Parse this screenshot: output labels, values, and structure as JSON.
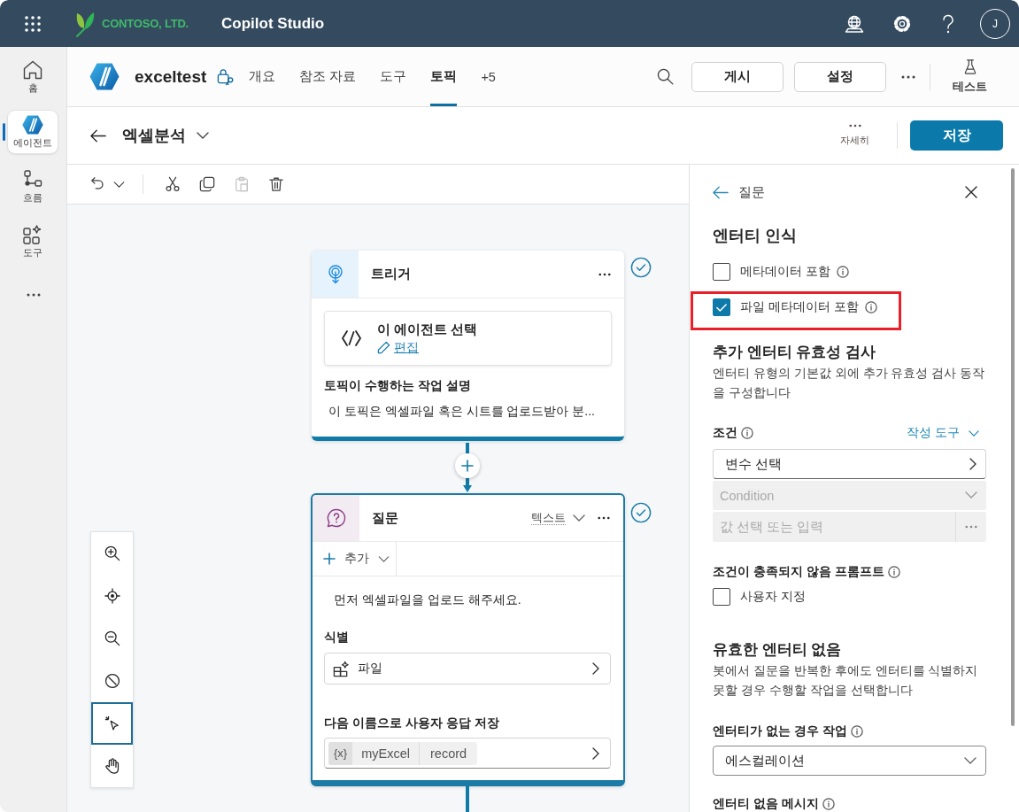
{
  "header": {
    "org_name": "CONTOSO, LTD.",
    "app_name": "Copilot Studio",
    "avatar_initial": "J"
  },
  "rail": {
    "items": [
      {
        "kind": "home",
        "label": "홈",
        "selected": false
      },
      {
        "kind": "agent",
        "label": "에이전트",
        "selected": true
      },
      {
        "kind": "flow",
        "label": "흐름",
        "selected": false
      },
      {
        "kind": "tools",
        "label": "도구",
        "selected": false
      }
    ]
  },
  "agent_bar": {
    "agent_name": "exceltest",
    "tabs": [
      {
        "label": "개요",
        "selected": false
      },
      {
        "label": "참조 자료",
        "selected": false
      },
      {
        "label": "도구",
        "selected": false
      },
      {
        "label": "토픽",
        "selected": true
      },
      {
        "label": "+5",
        "selected": false
      }
    ],
    "buttons": [
      "게시",
      "설정"
    ],
    "test_label": "테스트"
  },
  "topic_bar": {
    "topic_name": "엑셀분석",
    "more_label": "자세히",
    "save_label": "저장"
  },
  "toolbar": {
    "actions": [
      {
        "kind": "undo",
        "disabled": false
      },
      {
        "kind": "cut",
        "disabled": false
      },
      {
        "kind": "copy",
        "disabled": false
      },
      {
        "kind": "paste",
        "disabled": true
      },
      {
        "kind": "delete",
        "disabled": false
      }
    ]
  },
  "canvas": {
    "trigger_node": {
      "title": "트리거",
      "validated": true,
      "action_title": "이 에이전트 선택",
      "action_link": "편집",
      "description_label": "토픽이 수행하는 작업 설명",
      "description": "이 토픽은 엑셀파일 혹은 시트를 업로드받아 분..."
    },
    "question_node": {
      "title": "질문",
      "selected": true,
      "validated": true,
      "response_type": "텍스트",
      "add_label": "추가",
      "message": "먼저 엑셀파일을 업로드 해주세요.",
      "identify_label": "식별",
      "identify_value": "파일",
      "save_label": "다음 이름으로 사용자 응답 저장",
      "variable_symbol": "{x}",
      "variable_name": "myExcel",
      "variable_type": "record"
    },
    "zoom_controls": [
      {
        "kind": "zoom-in",
        "selected": false
      },
      {
        "kind": "recenter",
        "selected": false
      },
      {
        "kind": "zoom-out",
        "selected": false
      },
      {
        "kind": "minimap",
        "selected": false
      },
      {
        "kind": "select",
        "selected": true
      },
      {
        "kind": "pan",
        "selected": false
      }
    ]
  },
  "properties_panel": {
    "back_label": "질문",
    "title": "엔터티 인식",
    "checkboxes": [
      {
        "label": "메타데이터 포함",
        "checked": false,
        "highlighted": false
      },
      {
        "label": "파일 메타데이터 포함",
        "checked": true,
        "highlighted": true
      }
    ],
    "validation": {
      "title": "추가 엔터티 유효성 검사",
      "description": "엔터티 유형의 기본값 외에 추가 유효성 검사 동작을 구성합니다",
      "condition_label": "조건",
      "formula_link": "작성 도구",
      "variable_picker": "변수 선택",
      "operator_field": {
        "placeholder": "Condition",
        "disabled": true
      },
      "value_field": {
        "placeholder": "값 선택 또는 입력",
        "disabled": true
      }
    },
    "unmet_prompt": {
      "title": "조건이 충족되지 않음 프롬프트",
      "checkbox": {
        "label": "사용자 지정",
        "checked": false
      }
    },
    "no_entity": {
      "title": "유효한 엔터티 없음",
      "description": "봇에서 질문을 반복한 후에도 엔터티를 식별하지 못할 경우 수행할 작업을 선택합니다",
      "action_label": "엔터티가 없는 경우 작업",
      "action_value": "에스컬레이션",
      "message_label": "엔터티 없음 메시지"
    }
  }
}
